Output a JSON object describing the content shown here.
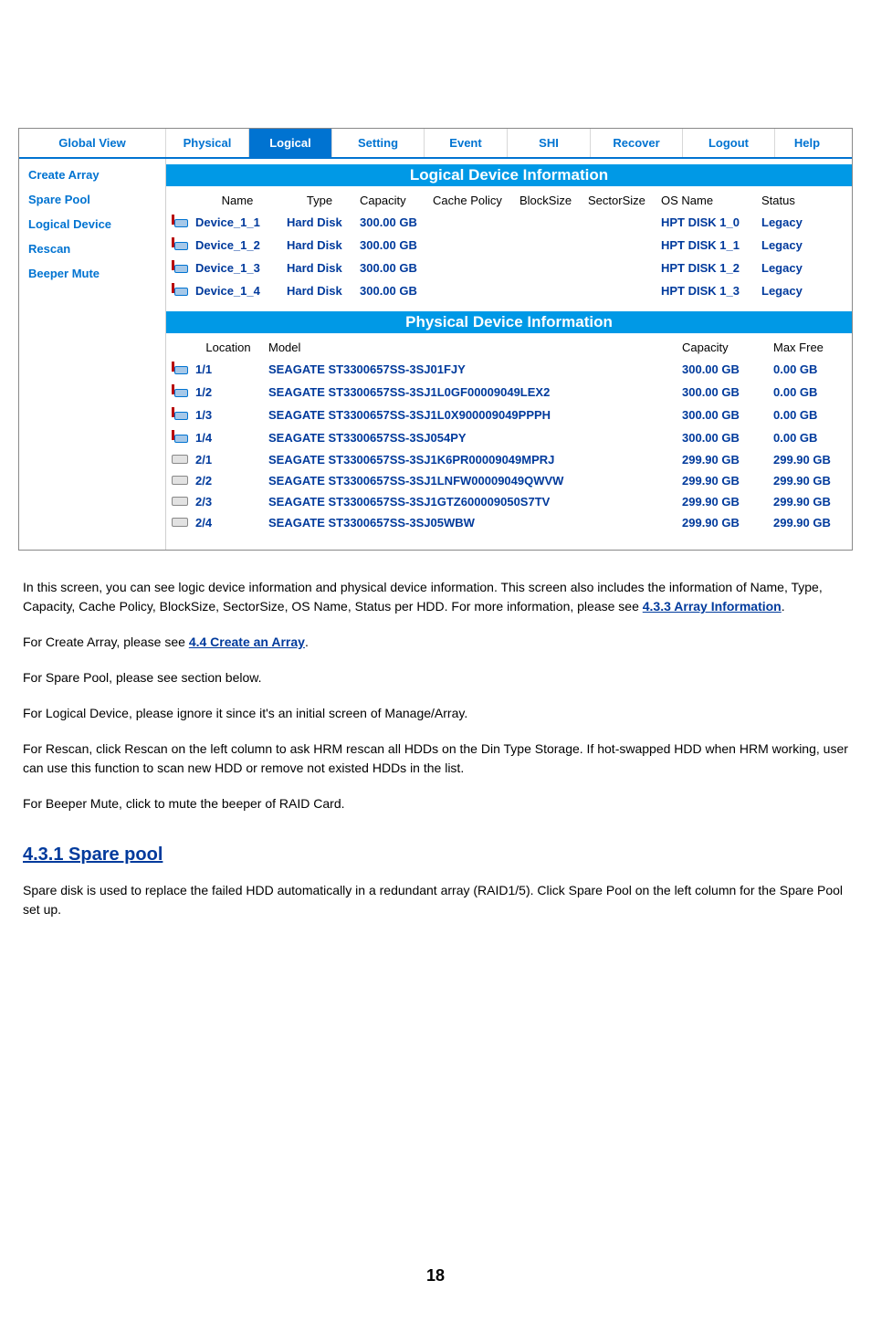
{
  "nav": {
    "global_view": "Global View",
    "physical": "Physical",
    "logical": "Logical",
    "setting": "Setting",
    "event": "Event",
    "shi": "SHI",
    "recover": "Recover",
    "logout": "Logout",
    "help": "Help"
  },
  "sidebar": {
    "create_array": "Create Array",
    "spare_pool": "Spare Pool",
    "logical_device": "Logical Device",
    "rescan": "Rescan",
    "beeper_mute": "Beeper Mute"
  },
  "sections": {
    "logical_title": "Logical Device Information",
    "physical_title": "Physical Device Information"
  },
  "logical_headers": {
    "name": "Name",
    "type": "Type",
    "capacity": "Capacity",
    "cache_policy": "Cache Policy",
    "block_size": "BlockSize",
    "sector_size": "SectorSize",
    "os_name": "OS Name",
    "status": "Status"
  },
  "logical_rows": [
    {
      "name": "Device_1_1",
      "type": "Hard Disk",
      "capacity": "300.00 GB",
      "cache": "",
      "block": "",
      "sector": "",
      "os": "HPT DISK 1_0",
      "status": "Legacy"
    },
    {
      "name": "Device_1_2",
      "type": "Hard Disk",
      "capacity": "300.00 GB",
      "cache": "",
      "block": "",
      "sector": "",
      "os": "HPT DISK 1_1",
      "status": "Legacy"
    },
    {
      "name": "Device_1_3",
      "type": "Hard Disk",
      "capacity": "300.00 GB",
      "cache": "",
      "block": "",
      "sector": "",
      "os": "HPT DISK 1_2",
      "status": "Legacy"
    },
    {
      "name": "Device_1_4",
      "type": "Hard Disk",
      "capacity": "300.00 GB",
      "cache": "",
      "block": "",
      "sector": "",
      "os": "HPT DISK 1_3",
      "status": "Legacy"
    }
  ],
  "physical_headers": {
    "location": "Location",
    "model": "Model",
    "capacity": "Capacity",
    "max_free": "Max Free"
  },
  "physical_rows": [
    {
      "icon": "blue",
      "location": "1/1",
      "model": "SEAGATE ST3300657SS-3SJ01FJY",
      "capacity": "300.00 GB",
      "maxfree": "0.00 GB"
    },
    {
      "icon": "blue",
      "location": "1/2",
      "model": "SEAGATE ST3300657SS-3SJ1L0GF00009049LEX2",
      "capacity": "300.00 GB",
      "maxfree": "0.00 GB"
    },
    {
      "icon": "blue",
      "location": "1/3",
      "model": "SEAGATE ST3300657SS-3SJ1L0X900009049PPPH",
      "capacity": "300.00 GB",
      "maxfree": "0.00 GB"
    },
    {
      "icon": "blue",
      "location": "1/4",
      "model": "SEAGATE ST3300657SS-3SJ054PY",
      "capacity": "300.00 GB",
      "maxfree": "0.00 GB"
    },
    {
      "icon": "gray",
      "location": "2/1",
      "model": "SEAGATE ST3300657SS-3SJ1K6PR00009049MPRJ",
      "capacity": "299.90 GB",
      "maxfree": "299.90 GB"
    },
    {
      "icon": "gray",
      "location": "2/2",
      "model": "SEAGATE ST3300657SS-3SJ1LNFW00009049QWVW",
      "capacity": "299.90 GB",
      "maxfree": "299.90 GB"
    },
    {
      "icon": "gray",
      "location": "2/3",
      "model": "SEAGATE ST3300657SS-3SJ1GTZ600009050S7TV",
      "capacity": "299.90 GB",
      "maxfree": "299.90 GB"
    },
    {
      "icon": "gray",
      "location": "2/4",
      "model": "SEAGATE ST3300657SS-3SJ05WBW",
      "capacity": "299.90 GB",
      "maxfree": "299.90 GB"
    }
  ],
  "doc": {
    "para1_a": "In this screen, you can see logic device information and physical device information. This screen also includes the information of Name, Type, Capacity, Cache Policy, BlockSize, SectorSize, OS Name, Status per HDD. For more information, please see ",
    "para1_link": "4.3.3 Array Information",
    "para1_b": ".",
    "para2_a": "For Create Array, please see ",
    "para2_link": "4.4 Create an Array",
    "para2_b": ".",
    "para3": "For Spare Pool, please see section below.",
    "para4": "For Logical Device, please ignore it since it's an initial screen of Manage/Array.",
    "para5": "For Rescan, click Rescan on the left column to ask HRM rescan all HDDs on the Din Type Storage. If hot-swapped HDD when HRM working, user can use this function to scan new HDD or remove not existed HDDs in the list.",
    "para6": "For Beeper Mute, click to mute the beeper of RAID Card.",
    "h3": "4.3.1 Spare pool",
    "para7": "Spare disk is used to replace the failed HDD automatically in a redundant array (RAID1/5). Click Spare Pool on the left column for the Spare Pool set up."
  },
  "pagenum": "18"
}
